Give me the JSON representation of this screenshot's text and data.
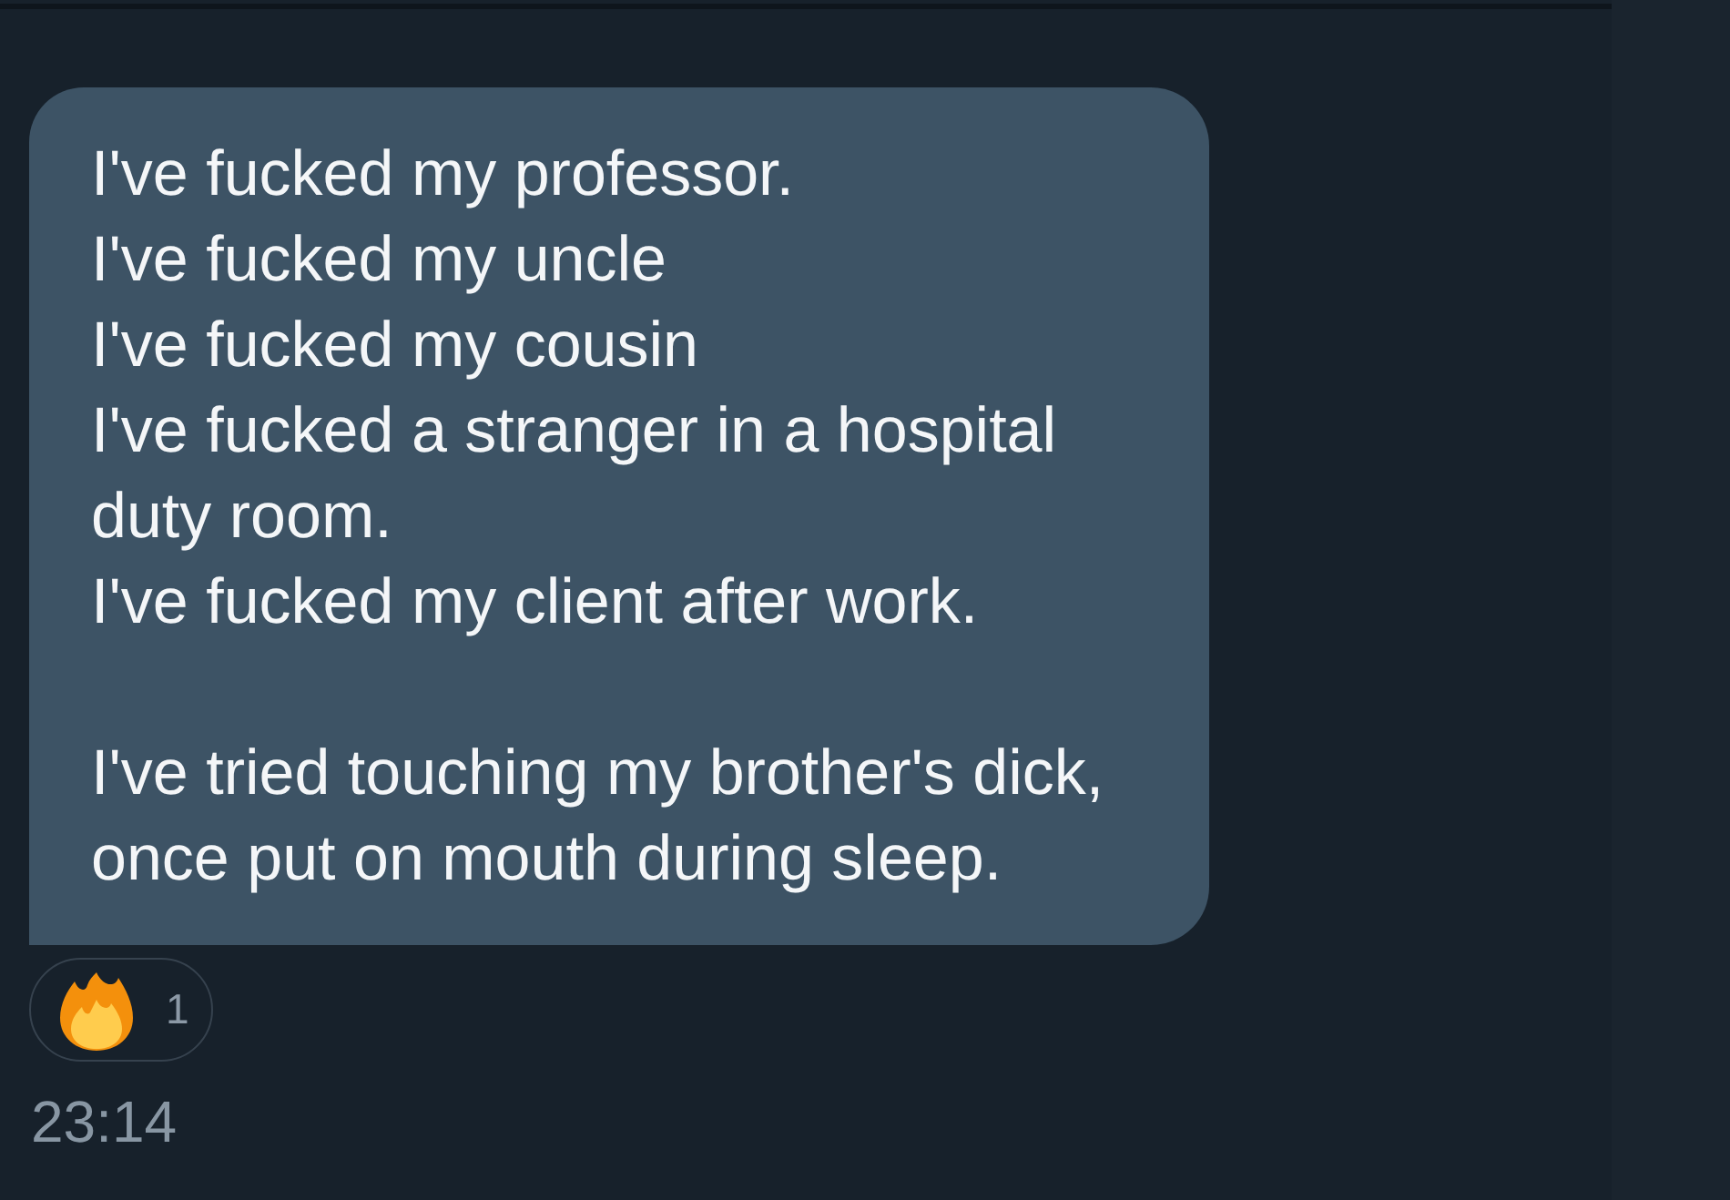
{
  "message": {
    "paragraphs": [
      {
        "lines": [
          "I've fucked my professor.",
          "I've fucked my uncle",
          "I've fucked my cousin",
          "I've fucked a stranger in a hospital",
          "duty room.",
          "I've fucked my client after work."
        ]
      },
      {
        "lines": [
          "I've tried touching my brother's dick,",
          "once put on mouth during sleep."
        ]
      }
    ],
    "reactions": [
      {
        "count": "1"
      }
    ],
    "time": "23:14"
  }
}
